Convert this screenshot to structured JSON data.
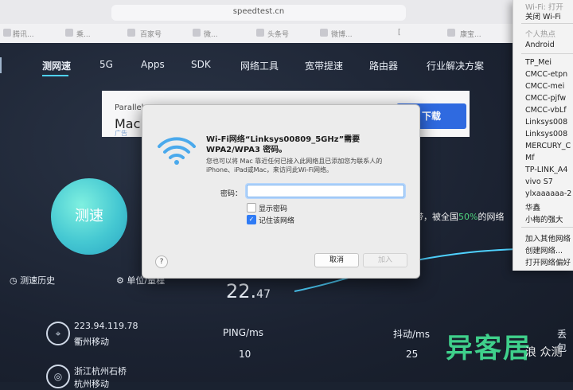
{
  "browser": {
    "url": "speedtest.cn",
    "bookmarks": [
      "腾讯...",
      "乘...",
      "百家号",
      "微...",
      "头条号",
      "微博...",
      "[",
      "康宝..."
    ]
  },
  "site": {
    "nav": [
      "测网速",
      "5G",
      "Apps",
      "SDK",
      "网络工具",
      "宽带提速",
      "路由器",
      "行业解决方案"
    ],
    "ad": {
      "title": "Parallel",
      "subtitle": "Mac",
      "tag": "广告",
      "download": "下载"
    },
    "go_label": "测速",
    "history_label": "测速历史",
    "unit_label": "单位/量程",
    "speed_value_main": "22.",
    "speed_value_dec": "47",
    "ping_label": "PING/ms",
    "ping_value": "10",
    "jitter_label": "抖动/ms",
    "jitter_value": "25",
    "loss_label": "丢包",
    "ip": "223.94.119.78",
    "isp": "衢州移动",
    "node": "浙江杭州石桥",
    "node_isp": "杭州移动",
    "side_note_pre": "宽带，被全国",
    "side_note_pct": "50%",
    "side_note_post": "的网络"
  },
  "dialog": {
    "title": "Wi-Fi网络“Linksys00809_5GHz”需要 WPA2/WPA3 密码。",
    "description": "您也可以将 Mac 靠近任何已接入此网络且已添加您为联系人的 iPhone、iPad或Mac，来访问此Wi-Fi网络。",
    "password_label": "密码：",
    "password_value": "",
    "show_password": "显示密码",
    "show_password_checked": false,
    "remember": "记住该网络",
    "remember_checked": true,
    "help": "?",
    "cancel": "取消",
    "join": "加入"
  },
  "wifi_menu": {
    "top_items": [
      "Wi-Fi: 打开",
      "关闭 Wi-Fi"
    ],
    "hotspot_header": "个人热点",
    "hotspots": [
      "Android"
    ],
    "networks": [
      "TP_Mei",
      "CMCC-etpn",
      "CMCC-mei",
      "CMCC-pjfw",
      "CMCC-vbLf",
      "Linksys008",
      "Linksys008",
      "MERCURY_C",
      "Mf",
      "TP-LINK_A4",
      "vivo S7",
      "ylxaaaaaa-2",
      "华鑫",
      "小梅的强大"
    ],
    "footer": [
      "加入其他网络",
      "创建网络...",
      "打开网络偏好"
    ]
  },
  "watermark": {
    "logo": "异客居",
    "tag": "浪 众测"
  },
  "colors": {
    "accent": "#4fd2ff",
    "go": "#45c8d2",
    "primary_button": "#2f6ae0",
    "checkbox": "#2f7bf5"
  }
}
